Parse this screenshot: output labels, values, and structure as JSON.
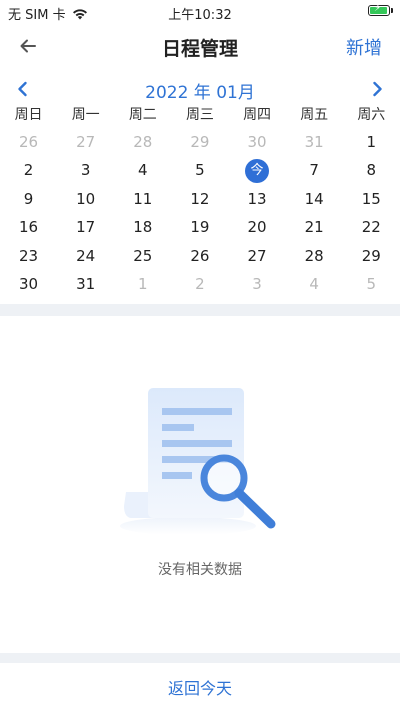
{
  "status": {
    "carrier": "无 SIM 卡",
    "time": "上午10:32"
  },
  "nav": {
    "title": "日程管理",
    "add_label": "新增"
  },
  "calendar": {
    "month_label": "2022 年 01月",
    "weekdays": [
      "周日",
      "周一",
      "周二",
      "周三",
      "周四",
      "周五",
      "周六"
    ],
    "weeks": [
      [
        {
          "label": "26",
          "muted": true
        },
        {
          "label": "27",
          "muted": true
        },
        {
          "label": "28",
          "muted": true
        },
        {
          "label": "29",
          "muted": true
        },
        {
          "label": "30",
          "muted": true
        },
        {
          "label": "31",
          "muted": true
        },
        {
          "label": "1",
          "muted": false
        }
      ],
      [
        {
          "label": "2",
          "muted": false
        },
        {
          "label": "3",
          "muted": false
        },
        {
          "label": "4",
          "muted": false
        },
        {
          "label": "5",
          "muted": false
        },
        {
          "label": "今",
          "muted": false,
          "today": true
        },
        {
          "label": "7",
          "muted": false
        },
        {
          "label": "8",
          "muted": false
        }
      ],
      [
        {
          "label": "9",
          "muted": false
        },
        {
          "label": "10",
          "muted": false
        },
        {
          "label": "11",
          "muted": false
        },
        {
          "label": "12",
          "muted": false
        },
        {
          "label": "13",
          "muted": false
        },
        {
          "label": "14",
          "muted": false
        },
        {
          "label": "15",
          "muted": false
        }
      ],
      [
        {
          "label": "16",
          "muted": false
        },
        {
          "label": "17",
          "muted": false
        },
        {
          "label": "18",
          "muted": false
        },
        {
          "label": "19",
          "muted": false
        },
        {
          "label": "20",
          "muted": false
        },
        {
          "label": "21",
          "muted": false
        },
        {
          "label": "22",
          "muted": false
        }
      ],
      [
        {
          "label": "23",
          "muted": false
        },
        {
          "label": "24",
          "muted": false
        },
        {
          "label": "25",
          "muted": false
        },
        {
          "label": "26",
          "muted": false
        },
        {
          "label": "27",
          "muted": false
        },
        {
          "label": "28",
          "muted": false
        },
        {
          "label": "29",
          "muted": false
        }
      ],
      [
        {
          "label": "30",
          "muted": false
        },
        {
          "label": "31",
          "muted": false
        },
        {
          "label": "1",
          "muted": true
        },
        {
          "label": "2",
          "muted": true
        },
        {
          "label": "3",
          "muted": true
        },
        {
          "label": "4",
          "muted": true
        },
        {
          "label": "5",
          "muted": true
        }
      ]
    ]
  },
  "empty_state": {
    "message": "没有相关数据"
  },
  "footer": {
    "today_label": "返回今天"
  },
  "colors": {
    "accent": "#2f73d4",
    "today_circle": "#2f6fd6",
    "muted_text": "#b8b8b8",
    "divider": "#eef1f5"
  },
  "icons": {
    "back": "arrow-left-icon",
    "prev_month": "chevron-left-icon",
    "next_month": "chevron-right-icon",
    "wifi": "wifi-icon",
    "battery": "battery-charging-icon",
    "empty": "document-search-icon"
  }
}
